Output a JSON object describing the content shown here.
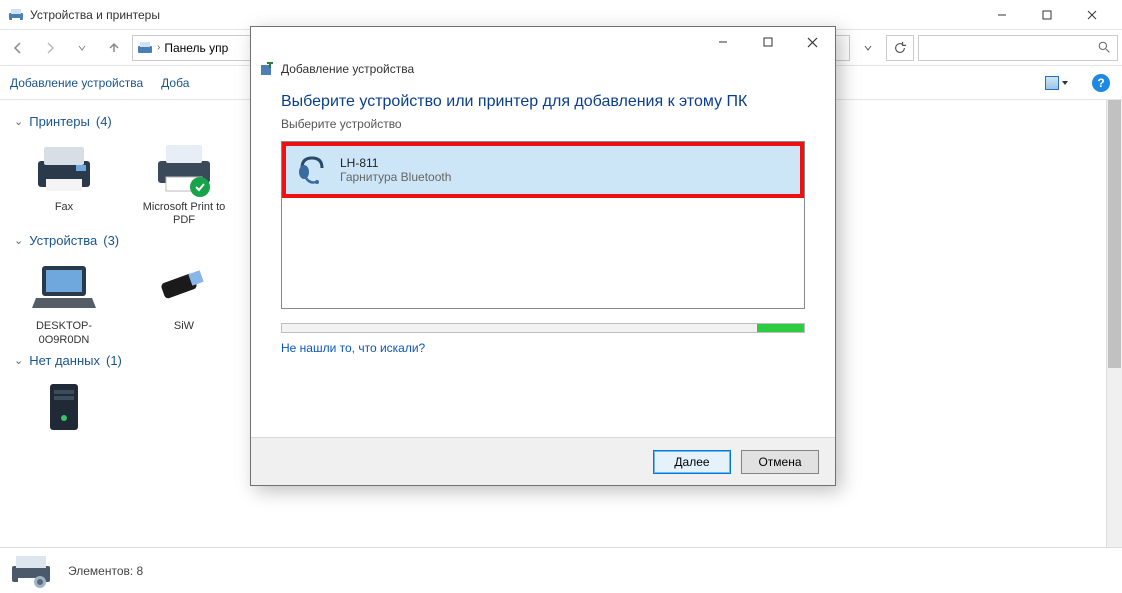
{
  "window": {
    "title": "Устройства и принтеры"
  },
  "nav": {
    "breadcrumb_root_icon": "devices-printers-icon",
    "breadcrumb_1": "Панель упр",
    "search_placeholder": ""
  },
  "toolbar": {
    "add_device": "Добавление устройства",
    "add_printer_prefix": "Доба"
  },
  "groups": {
    "printers": {
      "label": "Принтеры",
      "count": "(4)"
    },
    "devices": {
      "label": "Устройства",
      "count": "(3)"
    },
    "nodata": {
      "label": "Нет данных",
      "count": "(1)"
    }
  },
  "printer_items": [
    {
      "label": "Fax"
    },
    {
      "label": "Microsoft Print to PDF"
    }
  ],
  "device_items": [
    {
      "label": "DESKTOP-0O9R0DN"
    },
    {
      "label": "SiW"
    }
  ],
  "statusbar": {
    "text": "Элементов: 8"
  },
  "dialog": {
    "title": "Добавление устройства",
    "heading": "Выберите устройство или принтер для добавления к этому ПК",
    "subheading": "Выберите устройство",
    "device": {
      "name": "LH-811",
      "type": "Гарнитура Bluetooth"
    },
    "help_link": "Не нашли то, что искали?",
    "btn_next": "Далее",
    "btn_cancel": "Отмена"
  }
}
